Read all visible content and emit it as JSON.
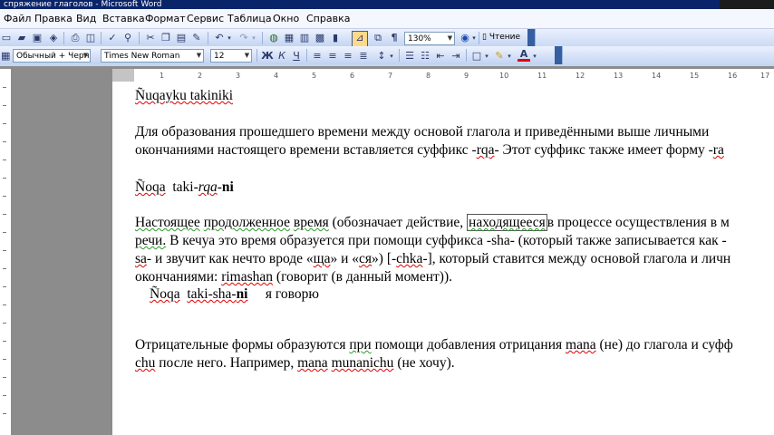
{
  "window": {
    "title": "спряжение глаголов - Microsoft Word"
  },
  "menu": [
    "Файл",
    "Правка",
    "Вид",
    "Вставка",
    "Формат",
    "Сервис",
    "Таблица",
    "Окно",
    "Справка"
  ],
  "toolbar": {
    "zoom": "130%",
    "reading_label": "Чтение"
  },
  "format_bar": {
    "style": "Обычный + Черн",
    "font": "Times New Roman",
    "size": "12",
    "bold": "Ж",
    "italic": "К",
    "underline": "Ч"
  },
  "ruler": {
    "labels": [
      "1",
      "2",
      "3",
      "4",
      "5",
      "6",
      "7",
      "8",
      "9",
      "10",
      "11",
      "12",
      "13",
      "14",
      "15",
      "16",
      "17"
    ]
  },
  "doc": {
    "heading": "Ñuqayku takiniki",
    "p1a": "Для образования прошедшего времени между основой глагола и приведёнными выше личными",
    "p1b_pre": "окончаниями настоящего времени вставляется суффикс -",
    "p1b_rqa": "rqa",
    "p1b_mid": "- Этот суффикс также имеет форму -",
    "p1b_end": "ra",
    "ex1_noqa": "Ñoqa",
    "ex1_taki": "taki-",
    "ex1_rqa": "rqa",
    "ex1_dash": "-",
    "ex1_ni": "ni",
    "p2a_w1": "Настоящее",
    "p2a_w2": "продолженное",
    "p2a_w3": "время",
    "p2a_w4": "(обозначает действие,",
    "p2a_w5": "находящееся",
    "p2a_w6": "в процессе осуществления в м",
    "p2b_w1": "речи.",
    "p2b_w2": "В кечуа это время образуется при помощи суффикса -sha- (который также записывается как -",
    "p2c_w1": "sa",
    "p2c_w2": "- и звучит как нечто вроде «",
    "p2c_w3": "ща",
    "p2c_w4": "» и «",
    "p2c_w5": "ся",
    "p2c_w6": "») [-",
    "p2c_w7": "chka",
    "p2c_w8": "-], который ставится между основой глагола и личн",
    "p2d_w1": "окончаниями:",
    "p2d_w2": "rimashan",
    "p2d_w3": "(говорит (в данный момент)).",
    "ex2_noqa": "Ñoqa",
    "ex2_taki": "taki-sha-",
    "ex2_ni": "ni",
    "ex2_tr": "я говорю",
    "p3a_w1": "Отрицательные формы образуются",
    "p3a_w2": "при",
    "p3a_w3": "помощи добавления отрицания",
    "p3a_w4": "mana",
    "p3a_w5": "(не) до глагола и суфф",
    "p3b_w1": "chu",
    "p3b_w2": "после него. Например,",
    "p3b_w3": "mana",
    "p3b_w4": "munanichu",
    "p3b_w5": "(не хочу)."
  }
}
